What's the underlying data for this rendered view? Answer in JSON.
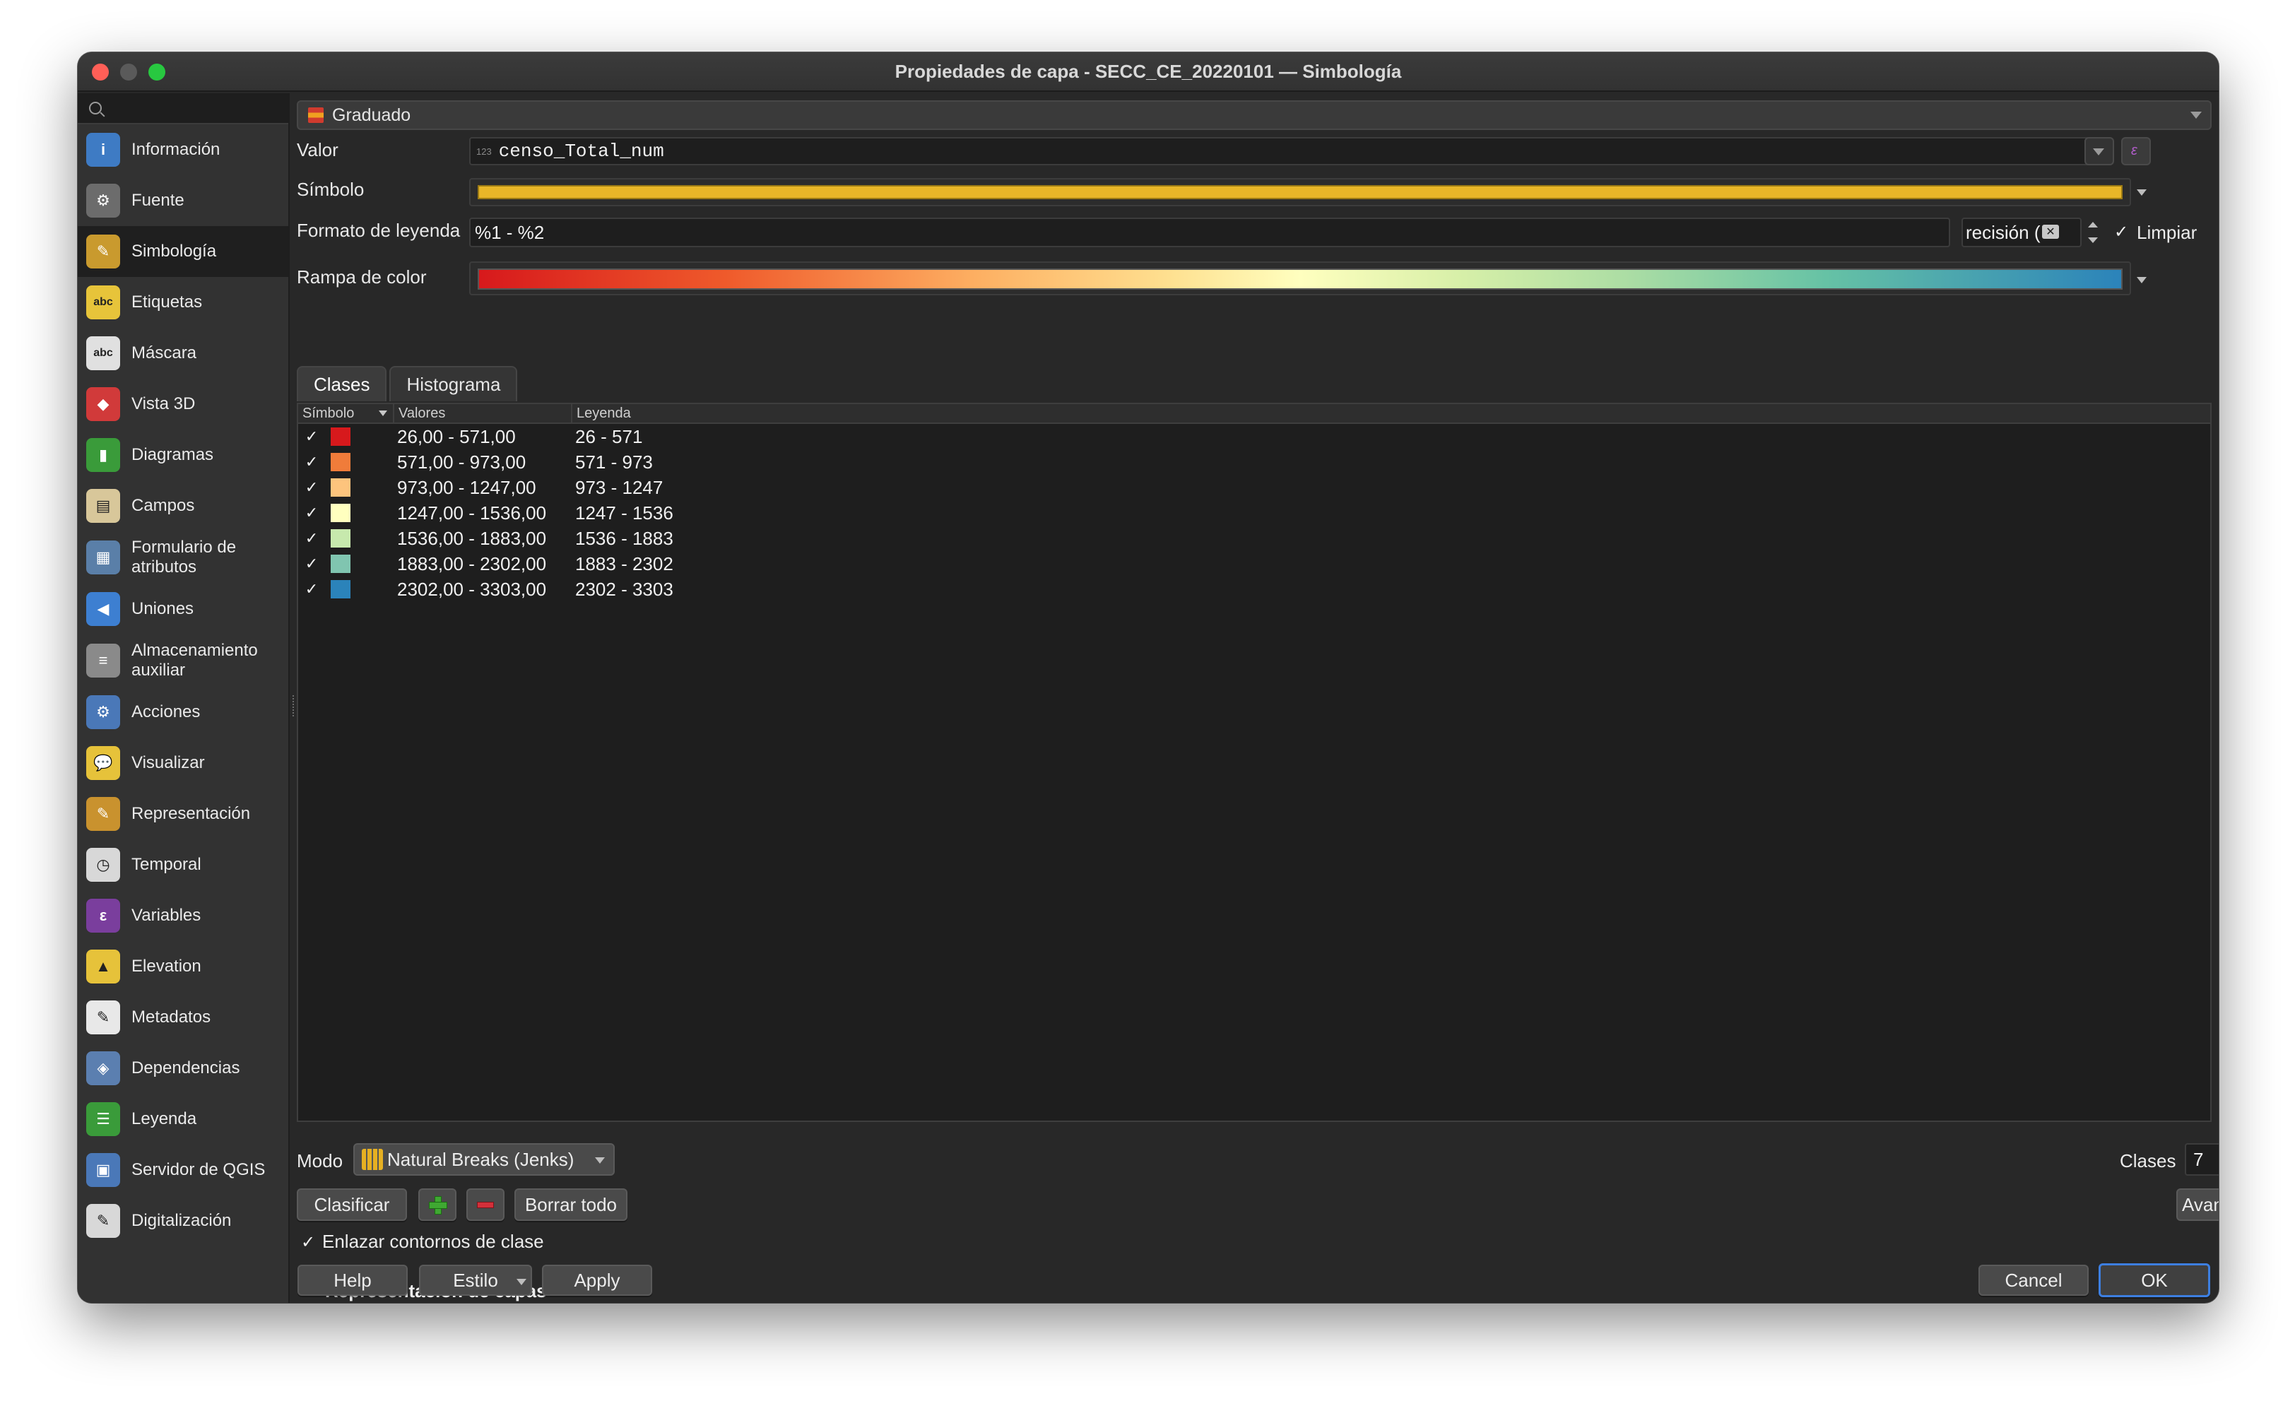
{
  "window": {
    "title": "Propiedades de capa - SECC_CE_20220101 — Simbología"
  },
  "sidebar": {
    "items": [
      {
        "label": "Información",
        "icon": "info-icon",
        "color": "#3e7bc4",
        "glyph": "i"
      },
      {
        "label": "Fuente",
        "icon": "source-icon",
        "color": "#6c6c6c",
        "glyph": "⚙"
      },
      {
        "label": "Simbología",
        "icon": "symbology-icon",
        "color": "#c99a2e",
        "glyph": "✎"
      },
      {
        "label": "Etiquetas",
        "icon": "labels-icon",
        "color": "#e7c43a",
        "glyph": "abc"
      },
      {
        "label": "Máscara",
        "icon": "mask-icon",
        "color": "#e0e0e0",
        "glyph": "abc"
      },
      {
        "label": "Vista 3D",
        "icon": "view-3d-icon",
        "color": "#d13a3a",
        "glyph": "◆"
      },
      {
        "label": "Diagramas",
        "icon": "diagrams-icon",
        "color": "#3a9b3a",
        "glyph": "▮"
      },
      {
        "label": "Campos",
        "icon": "fields-icon",
        "color": "#d8c79a",
        "glyph": "▤"
      },
      {
        "label": "Formulario de atributos",
        "icon": "attribute-form-icon",
        "color": "#5a7fa8",
        "glyph": "▦"
      },
      {
        "label": "Uniones",
        "icon": "joins-icon",
        "color": "#3d7fd1",
        "glyph": "◀"
      },
      {
        "label": "Almacenamiento auxiliar",
        "icon": "auxiliary-storage-icon",
        "color": "#8a8a8a",
        "glyph": "≡"
      },
      {
        "label": "Acciones",
        "icon": "actions-icon",
        "color": "#4a78b8",
        "glyph": "⚙"
      },
      {
        "label": "Visualizar",
        "icon": "display-icon",
        "color": "#e6c23a",
        "glyph": "💬"
      },
      {
        "label": "Representación",
        "icon": "rendering-icon",
        "color": "#c9922e",
        "glyph": "✎"
      },
      {
        "label": "Temporal",
        "icon": "temporal-icon",
        "color": "#d8d8d8",
        "glyph": "◷"
      },
      {
        "label": "Variables",
        "icon": "variables-icon",
        "color": "#7a3e9d",
        "glyph": "ε"
      },
      {
        "label": "Elevation",
        "icon": "elevation-icon",
        "color": "#e6c23a",
        "glyph": "▲"
      },
      {
        "label": "Metadatos",
        "icon": "metadata-icon",
        "color": "#e8e8e8",
        "glyph": "✎"
      },
      {
        "label": "Dependencias",
        "icon": "dependencies-icon",
        "color": "#5b7fb0",
        "glyph": "◈"
      },
      {
        "label": "Leyenda",
        "icon": "legend-icon",
        "color": "#3a9b3a",
        "glyph": "☰"
      },
      {
        "label": "Servidor de QGIS",
        "icon": "qgis-server-icon",
        "color": "#4a78b8",
        "glyph": "▣"
      },
      {
        "label": "Digitalización",
        "icon": "digitizing-icon",
        "color": "#d8d8d8",
        "glyph": "✎"
      }
    ],
    "active_index": 2
  },
  "renderer": {
    "label": "Graduado"
  },
  "value_field": {
    "label": "Valor",
    "type_badge": "123",
    "value": "censo_Total_num"
  },
  "symbol": {
    "label": "Símbolo",
    "color": "#e8b628"
  },
  "legend_format": {
    "label": "Formato de leyenda",
    "value": "%1 - %2",
    "precision_text": "recisión (",
    "trim_label": "Limpiar",
    "trim_checked": "✓"
  },
  "color_ramp": {
    "label": "Rampa de color"
  },
  "tabs": [
    {
      "label": "Clases"
    },
    {
      "label": "Histograma"
    }
  ],
  "table": {
    "headers": {
      "symbol": "Símbolo",
      "values": "Valores",
      "legend": "Leyenda"
    },
    "rows": [
      {
        "check": "✓",
        "color": "#d7191c",
        "values": "26,00 - 571,00",
        "legend": "26 - 571"
      },
      {
        "check": "✓",
        "color": "#f07c3a",
        "values": "571,00 - 973,00",
        "legend": "571 - 973"
      },
      {
        "check": "✓",
        "color": "#fdc47d",
        "values": "973,00 - 1247,00",
        "legend": "973 - 1247"
      },
      {
        "check": "✓",
        "color": "#ffffbf",
        "values": "1247,00 - 1536,00",
        "legend": "1247 - 1536"
      },
      {
        "check": "✓",
        "color": "#c7e9ad",
        "values": "1536,00 - 1883,00",
        "legend": "1536 - 1883"
      },
      {
        "check": "✓",
        "color": "#80c5b0",
        "values": "1883,00 - 2302,00",
        "legend": "1883 - 2302"
      },
      {
        "check": "✓",
        "color": "#2b83ba",
        "values": "2302,00 - 3303,00",
        "legend": "2302 - 3303"
      }
    ]
  },
  "mode": {
    "label": "Modo",
    "value": "Natural Breaks (Jenks)"
  },
  "classes": {
    "label": "Clases",
    "value": "7"
  },
  "actions": {
    "classify": "Clasificar",
    "delete_all": "Borrar todo",
    "advanced": "Avanzado"
  },
  "link_boundaries": {
    "check": "✓",
    "label": "Enlazar contornos de clase"
  },
  "layer_rendering": {
    "label": "Representación de capas"
  },
  "footer": {
    "help": "Help",
    "style": "Estilo",
    "apply": "Apply",
    "cancel": "Cancel",
    "ok": "OK"
  }
}
